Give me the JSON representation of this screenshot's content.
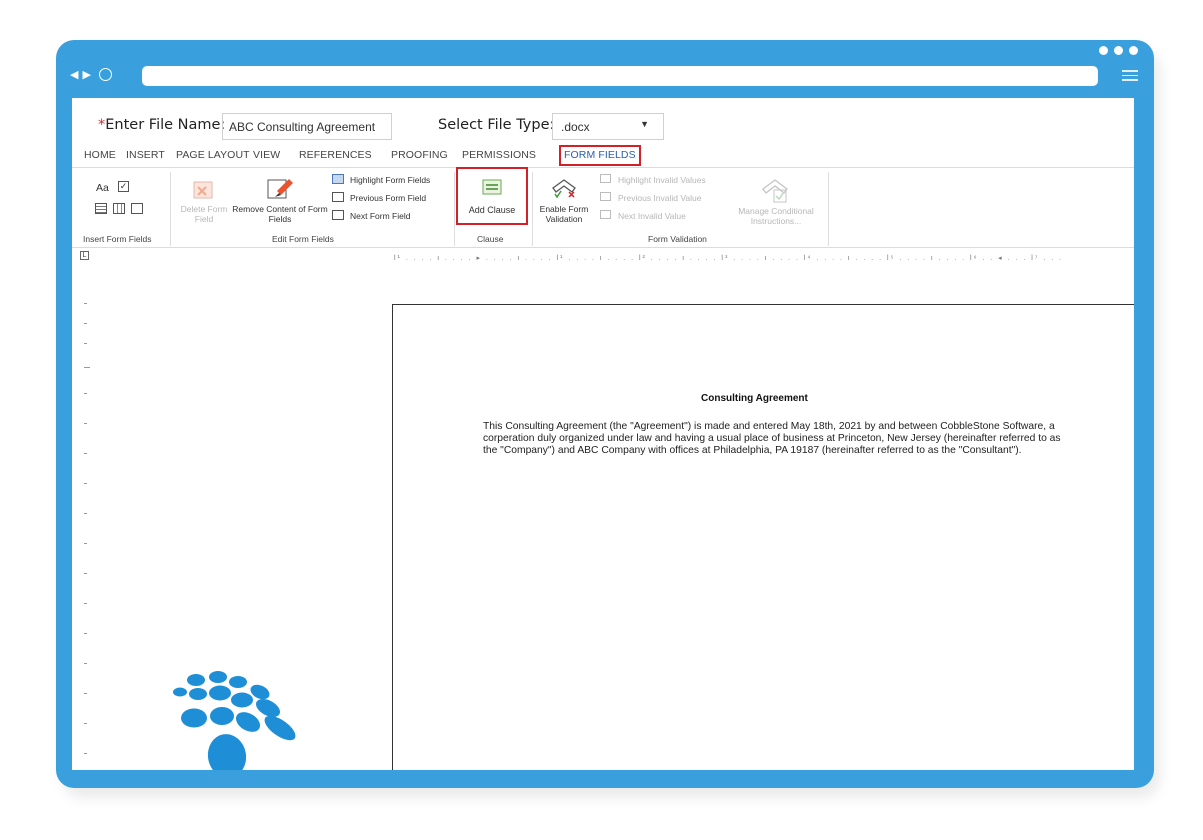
{
  "file_bar": {
    "required_mark": "*",
    "file_name_label": "Enter File Name:",
    "file_name_value": "ABC Consulting Agreement",
    "file_type_label": "Select File Type:",
    "file_type_value": ".docx"
  },
  "tabs": [
    "HOME",
    "INSERT",
    "PAGE LAYOUT",
    "VIEW",
    "REFERENCES",
    "PROOFING",
    "PERMISSIONS",
    "FORM FIELDS"
  ],
  "active_tab": "FORM FIELDS",
  "ribbon": {
    "insert_form_fields": {
      "label": "Insert Form Fields",
      "text_icon": "Aa"
    },
    "edit_form_fields": {
      "label": "Edit Form Fields",
      "delete_form_field": "Delete Form Field",
      "remove_content": "Remove Content of Form Fields",
      "highlight": "Highlight Form Fields",
      "previous": "Previous Form Field",
      "next": "Next Form Field"
    },
    "clause": {
      "label": "Clause",
      "add_clause": "Add Clause"
    },
    "form_validation": {
      "label": "Form Validation",
      "enable": "Enable Form Validation",
      "highlight_invalid": "Highlight Invalid Values",
      "previous_invalid": "Previous Invalid Value",
      "next_invalid": "Next Invalid Value",
      "manage_conditional": "Manage Conditional Instructions..."
    }
  },
  "ruler": {
    "tab_marker": "L"
  },
  "document": {
    "title": "Consulting Agreement",
    "body": "This Consulting Agreement (the \"Agreement\") is made and entered May 18th, 2021 by and between CobbleStone Software, a corperation duly organized under law and having a usual place of business at Princeton, New Jersey (hereinafter referred to as the \"Company\") and ABC Company with offices at Philadelphia, PA 19187 (hereinafter referred to as the \"Consultant\")."
  },
  "colors": {
    "frame": "#3aa0dd",
    "highlight_box": "#d42027",
    "active_tab": "#2a5fa8",
    "logo": "#1e8fd6"
  }
}
